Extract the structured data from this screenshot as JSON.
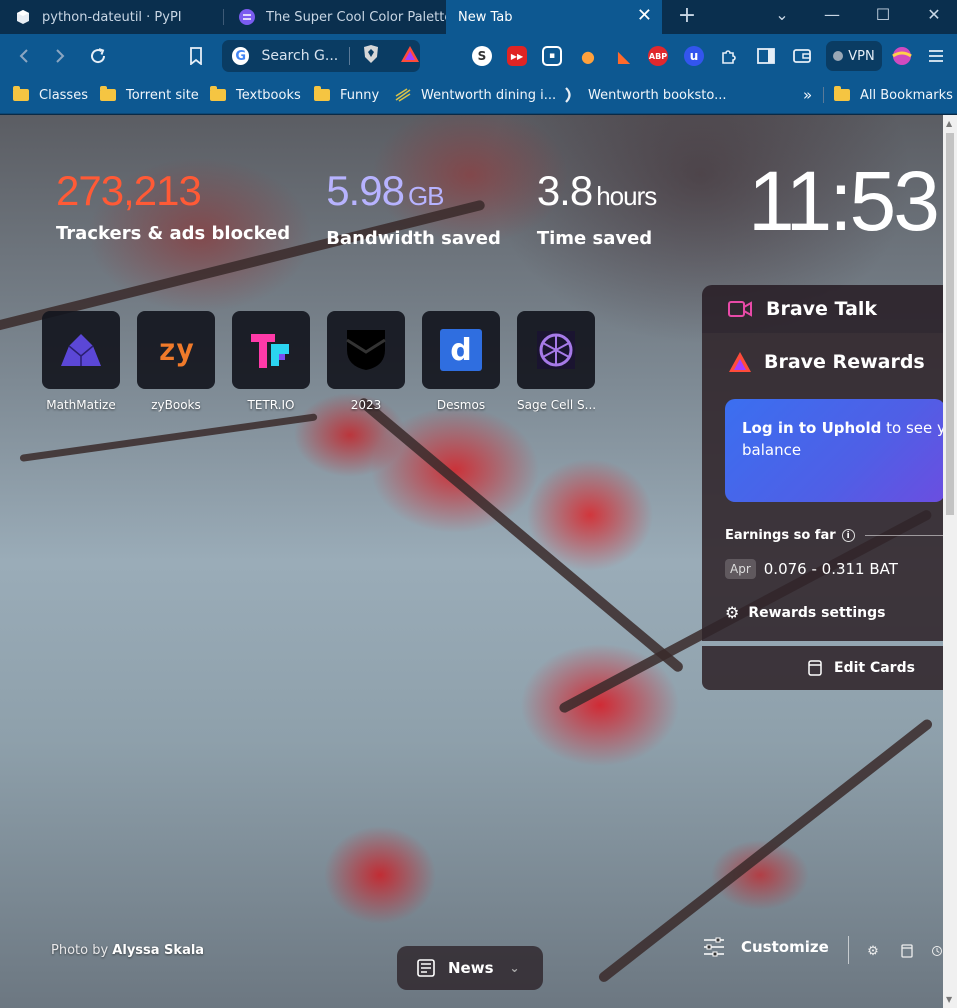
{
  "tabs": [
    {
      "title": "python-dateutil · PyPI",
      "icon": "pypi-cube-icon"
    },
    {
      "title": "The Super Cool Color Palette",
      "icon": "palette-site-icon"
    },
    {
      "title": "New Tab",
      "icon": "none",
      "active": true
    }
  ],
  "toolbar": {
    "search_placeholder": "Search G...",
    "vpn_label": "VPN",
    "extensions": [
      {
        "name": "s-extension-icon",
        "label": "S",
        "color": "#ffffff",
        "bg": "#444"
      },
      {
        "name": "youtube-extension-icon",
        "label": "▶▶",
        "color": "#ffffff",
        "bg": "#e02424"
      },
      {
        "name": "pip-extension-icon",
        "label": "▣",
        "color": "#ffffff",
        "bg": "#333"
      },
      {
        "name": "orange-extension-icon",
        "label": "●",
        "color": "#ffa13c",
        "bg": "transparent"
      },
      {
        "name": "megaphone-extension-icon",
        "label": "◣",
        "color": "#ff6a2b",
        "bg": "transparent"
      },
      {
        "name": "adblock-plus-icon",
        "label": "ABP",
        "color": "#ffffff",
        "bg": "#e0282e"
      },
      {
        "name": "ublock-icon",
        "label": "u",
        "color": "#ffffff",
        "bg": "#3355ee"
      },
      {
        "name": "extensions-puzzle-icon",
        "label": "✦",
        "color": "#e5eef7",
        "bg": "transparent"
      }
    ]
  },
  "bookmarks": {
    "items": [
      {
        "label": "Classes",
        "type": "folder"
      },
      {
        "label": "Torrent site",
        "type": "folder"
      },
      {
        "label": "Textbooks",
        "type": "folder"
      },
      {
        "label": "Funny",
        "type": "folder"
      },
      {
        "label": "Wentworth dining i...",
        "type": "site"
      },
      {
        "label": "Wentworth booksto...",
        "type": "site"
      }
    ],
    "overflow": "»",
    "all_label": "All Bookmarks"
  },
  "stats": [
    {
      "value": "273,213",
      "unit": "",
      "label": "Trackers & ads blocked",
      "color": "#ff5a36"
    },
    {
      "value": "5.98",
      "unit": "GB",
      "label": "Bandwidth saved",
      "color": "#b7b3ff"
    },
    {
      "value": "3.8",
      "unit": "hours",
      "label": "Time saved",
      "color": "#ffffff"
    }
  ],
  "clock": "11:53",
  "top_sites": [
    {
      "name": "MathMatize"
    },
    {
      "name": "zyBooks"
    },
    {
      "name": "TETR.IO"
    },
    {
      "name": "2023"
    },
    {
      "name": "Desmos"
    },
    {
      "name": "Sage Cell S..."
    }
  ],
  "cards": {
    "talk_title": "Brave Talk",
    "rewards_title": "Brave Rewards",
    "uphold_bold": "Log in to Uphold",
    "uphold_rest": " to see your",
    "uphold_line2": "balance",
    "earnings_label": "Earnings so far",
    "earnings_month": "Apr",
    "earnings_value": "0.076 - 0.311 BAT",
    "settings_label": "Rewards settings",
    "edit_label": "Edit Cards"
  },
  "footer": {
    "photo_prefix": "Photo by ",
    "photo_author": "Alyssa Skala",
    "news_label": "News",
    "customize_label": "Customize"
  },
  "colors": {
    "accent": "#0d5891",
    "tab_bg": "#0a2f4e",
    "trackers": "#ff5a36",
    "bandwidth": "#b7b3ff"
  }
}
